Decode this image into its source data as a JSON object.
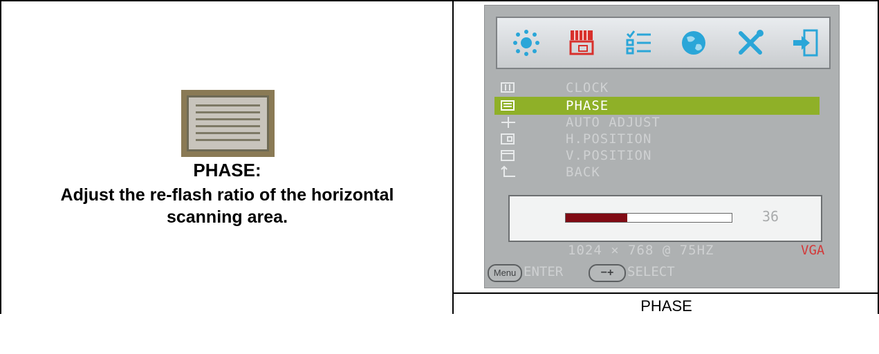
{
  "left": {
    "title": "PHASE:",
    "description_line1": "Adjust the re-flash ratio of the horizontal",
    "description_line2": "scanning area."
  },
  "osd": {
    "top_icons": [
      "brightness-icon",
      "image-icon",
      "menu-list-icon",
      "globe-icon",
      "tools-icon",
      "exit-icon"
    ],
    "menu_items": [
      {
        "icon": "clock-icon",
        "label": "CLOCK"
      },
      {
        "icon": "phase-icon",
        "label": "PHASE"
      },
      {
        "icon": "auto-adjust-icon",
        "label": "AUTO ADJUST"
      },
      {
        "icon": "h-position-icon",
        "label": "H.POSITION"
      },
      {
        "icon": "v-position-icon",
        "label": "V.POSITION"
      },
      {
        "icon": "back-icon",
        "label": "BACK"
      }
    ],
    "selected_item": "PHASE",
    "slider": {
      "value": 36,
      "fill_fraction": 0.37
    },
    "resolution": "1024 × 768 @ 75HZ",
    "source": "VGA",
    "menu_key": "Menu",
    "enter_label": "ENTER",
    "adjust_key": "−+",
    "select_label": "SELECT"
  },
  "caption": "PHASE",
  "colors": {
    "selected_row": "#8fb028",
    "slider_fill": "#800a14",
    "source_label": "#d23a3a"
  }
}
